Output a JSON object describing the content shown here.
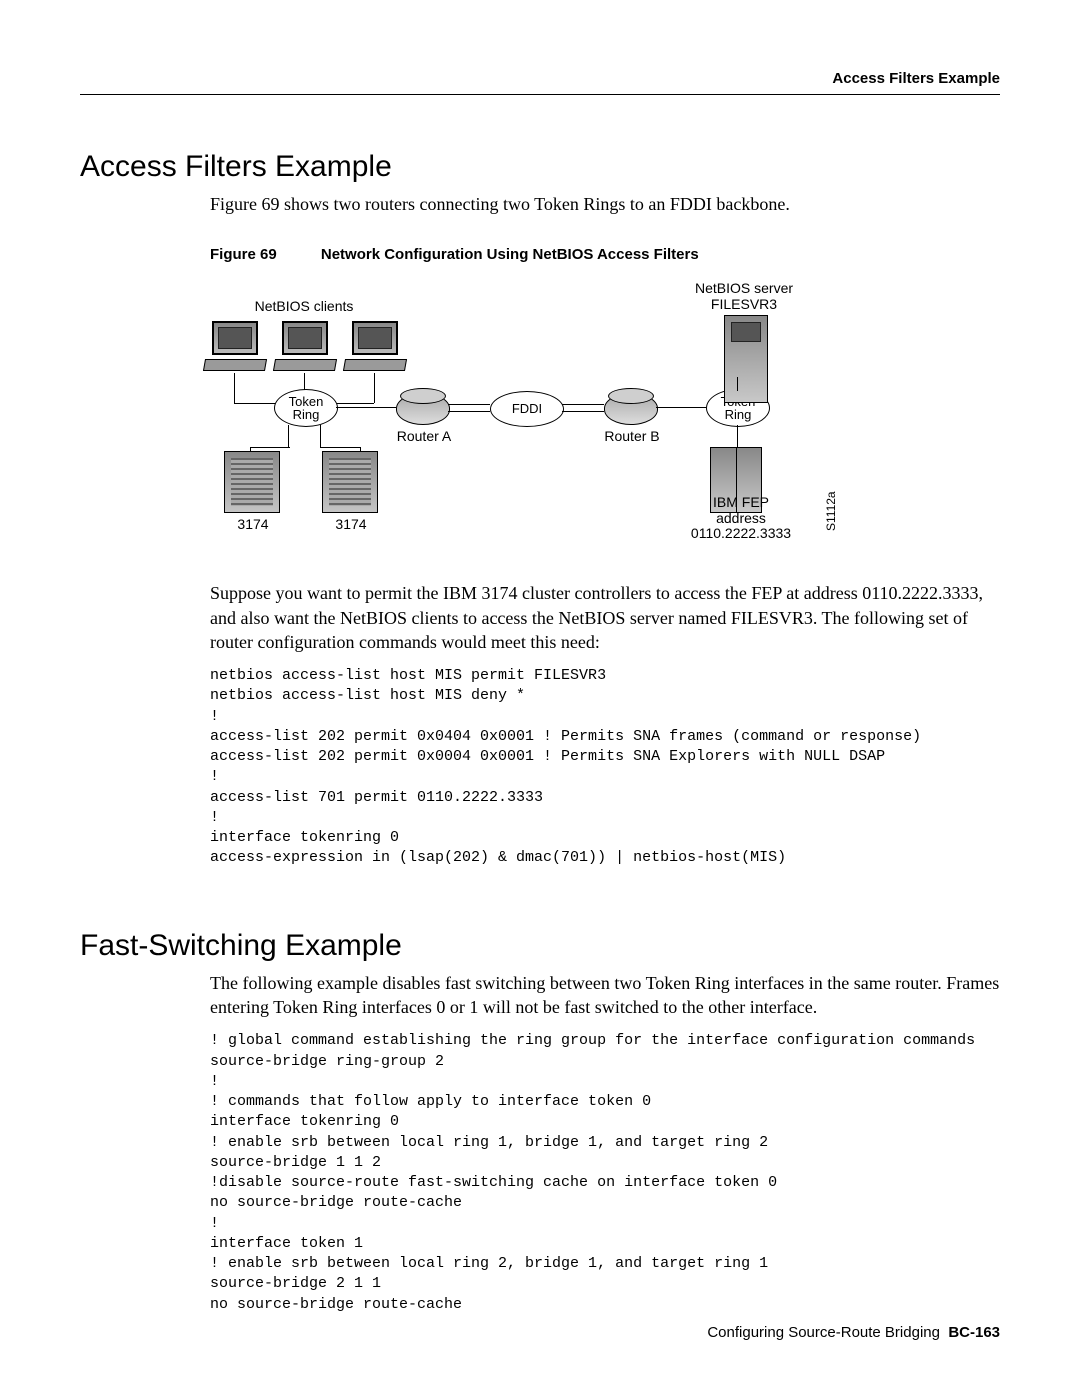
{
  "header": {
    "running": "Access Filters Example"
  },
  "section1": {
    "title": "Access Filters Example",
    "intro": "Figure 69 shows two routers connecting two Token Rings to an FDDI backbone.",
    "figure": {
      "label": "Figure 69",
      "title": "Network Configuration Using NetBIOS Access Filters",
      "labels": {
        "netbios_clients": "NetBIOS clients",
        "netbios_server": "NetBIOS server\nFILESVR3",
        "token_ring_a": "Token\nRing",
        "token_ring_b": "Token\nRing",
        "fddi": "FDDI",
        "router_a": "Router A",
        "router_b": "Router B",
        "c3174_a": "3174",
        "c3174_b": "3174",
        "fep": "IBM FEP\naddress\n0110.2222.3333",
        "diagram_id": "S1112a"
      }
    },
    "paragraph": "Suppose you want to permit the IBM 3174 cluster controllers to access the FEP at address 0110.2222.3333, and also want the NetBIOS clients to access the NetBIOS server named FILESVR3. The following set of router configuration commands would meet this need:",
    "code": "netbios access-list host MIS permit FILESVR3\nnetbios access-list host MIS deny *\n!\naccess-list 202 permit 0x0404 0x0001 ! Permits SNA frames (command or response)\naccess-list 202 permit 0x0004 0x0001 ! Permits SNA Explorers with NULL DSAP\n!\naccess-list 701 permit 0110.2222.3333\n!\ninterface tokenring 0\naccess-expression in (lsap(202) & dmac(701)) | netbios-host(MIS)"
  },
  "section2": {
    "title": "Fast-Switching Example",
    "intro": "The following example disables fast switching between two Token Ring interfaces in the same router. Frames entering Token Ring interfaces 0 or 1 will not be fast switched to the other interface.",
    "code": "! global command establishing the ring group for the interface configuration commands\nsource-bridge ring-group 2\n!\n! commands that follow apply to interface token 0\ninterface tokenring 0\n! enable srb between local ring 1, bridge 1, and target ring 2\nsource-bridge 1 1 2\n!disable source-route fast-switching cache on interface token 0\nno source-bridge route-cache\n!\ninterface token 1\n! enable srb between local ring 2, bridge 1, and target ring 1\nsource-bridge 2 1 1\nno source-bridge route-cache"
  },
  "footer": {
    "text": "Configuring Source-Route Bridging",
    "page": "BC-163"
  }
}
